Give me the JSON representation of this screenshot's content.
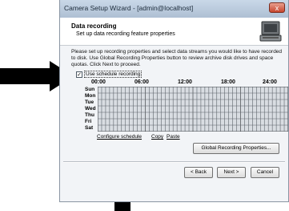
{
  "window": {
    "title": "Camera Setup Wizard - [admin@localhost]",
    "close_glyph": "x"
  },
  "header": {
    "title": "Data recording",
    "subtitle": "Set up data recording feature properties",
    "icon": "camera-computer-icon"
  },
  "description": "Please set up recording properties and select data streams you would like to have recorded to disk. Use Global Recording Properties button to review archive disk drives and space quotas. Click Next to proceed.",
  "schedule": {
    "checkbox_label": "Use schedule recording",
    "checked": true,
    "hours": [
      "00:00",
      "06:00",
      "12:00",
      "18:00",
      "24:00"
    ],
    "days": [
      "Sun",
      "Mon",
      "Tue",
      "Wed",
      "Thu",
      "Fri",
      "Sat"
    ],
    "links": {
      "configure": "Configure schedule",
      "copy": "Copy",
      "paste": "Paste"
    }
  },
  "buttons": {
    "global_recording": "Global Recording Properties...",
    "back": "< Back",
    "next": "Next >",
    "cancel": "Cancel"
  },
  "annotations": {
    "arrow_color": "#000000"
  }
}
